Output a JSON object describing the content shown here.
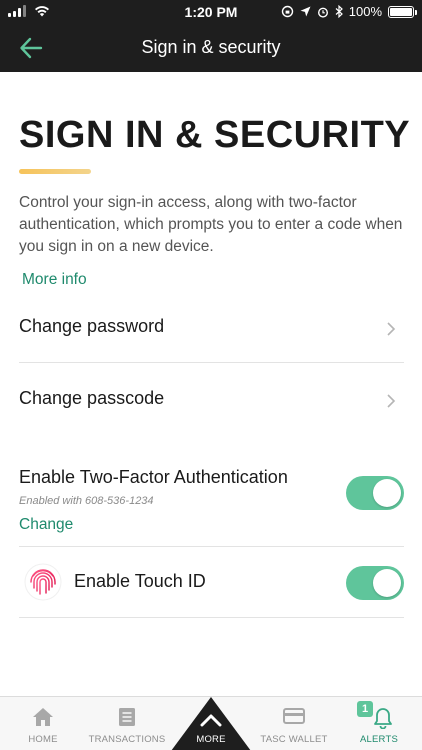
{
  "status_bar": {
    "time": "1:20 PM",
    "battery": "100%"
  },
  "nav": {
    "title": "Sign in & security",
    "back_icon": "arrow-left-icon"
  },
  "page": {
    "heading": "SIGN IN & SECURITY",
    "description": "Control your sign-in access, along with two-factor authentication, which prompts you to enter a code when you sign in on a new device.",
    "more_info_label": "More info"
  },
  "settings": {
    "change_password": "Change password",
    "change_passcode": "Change passcode",
    "two_factor": {
      "label": "Enable Two-Factor Authentication",
      "detail": "Enabled with 608-536-1234",
      "change_label": "Change",
      "enabled": true
    },
    "touch_id": {
      "label": "Enable Touch ID",
      "enabled": true
    }
  },
  "tab_bar": {
    "tabs": [
      {
        "label": "HOME",
        "icon": "home-icon"
      },
      {
        "label": "TRANSACTIONS",
        "icon": "document-icon"
      },
      {
        "label": "MORE",
        "icon": "chevron-up-icon"
      },
      {
        "label": "TASC WALLET",
        "icon": "card-icon"
      },
      {
        "label": "ALERTS",
        "icon": "bell-icon",
        "badge": "1"
      }
    ]
  },
  "colors": {
    "accent": "#1f8a6d",
    "toggle_on": "#5fc59b",
    "header_bg": "#1e1e1e",
    "title_underline": "#f6c35a"
  }
}
